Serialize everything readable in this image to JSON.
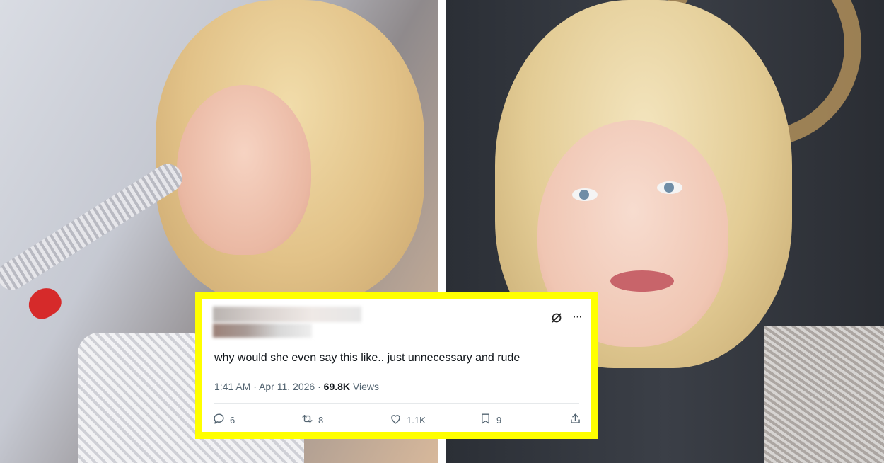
{
  "tweet": {
    "text": "why would she even say this like.. just unnecessary and rude",
    "time": "1:41 AM",
    "dot1": "·",
    "date": "Apr 11, 2026",
    "dot2": "·",
    "views_count": "69.8K",
    "views_label": "Views",
    "actions": {
      "replies": "6",
      "reposts": "8",
      "likes": "1.1K",
      "bookmarks": "9"
    },
    "more_glyph": "···",
    "icons": [
      "grok-icon",
      "more-icon",
      "reply-icon",
      "repost-icon",
      "like-icon",
      "bookmark-icon",
      "share-icon"
    ]
  },
  "colors": {
    "highlight_border": "#ffff00",
    "text_primary": "#0f1419",
    "text_secondary": "#536471"
  }
}
